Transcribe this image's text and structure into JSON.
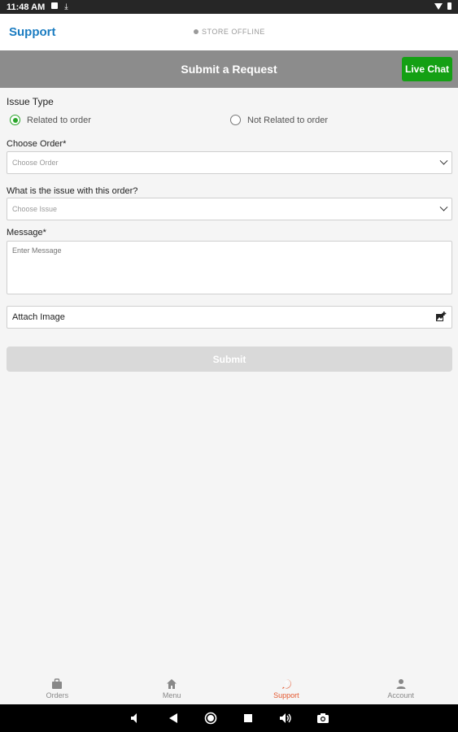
{
  "status_bar": {
    "time": "11:48 AM"
  },
  "header": {
    "title": "Support",
    "store_status": "STORE OFFLINE"
  },
  "request_bar": {
    "title": "Submit a Request",
    "live_chat_label": "Live Chat",
    "live_chat_color": "#14a014"
  },
  "form": {
    "issue_type_label": "Issue Type",
    "issue_options": [
      "Related to order",
      "Not Related to order"
    ],
    "selected_issue_option": "Related to order",
    "order_label": "Choose Order*",
    "order_placeholder": "Choose Order",
    "issue_label": "What is the issue with this order?",
    "issue_placeholder": "Choose Issue",
    "message_label": "Message*",
    "message_placeholder": "Enter Message",
    "attach_label": "Attach Image",
    "submit_label": "Submit"
  },
  "bottom_nav": {
    "items": [
      {
        "label": "Orders",
        "icon": "bag-icon"
      },
      {
        "label": "Menu",
        "icon": "home-icon"
      },
      {
        "label": "Support",
        "icon": "help-icon"
      },
      {
        "label": "Account",
        "icon": "person-icon"
      }
    ],
    "active": "Support",
    "active_color": "#e4572e"
  },
  "colors": {
    "brand_blue": "#1a7cc1",
    "header_gray": "#8c8c8c",
    "radio_green": "#2aa52a"
  }
}
